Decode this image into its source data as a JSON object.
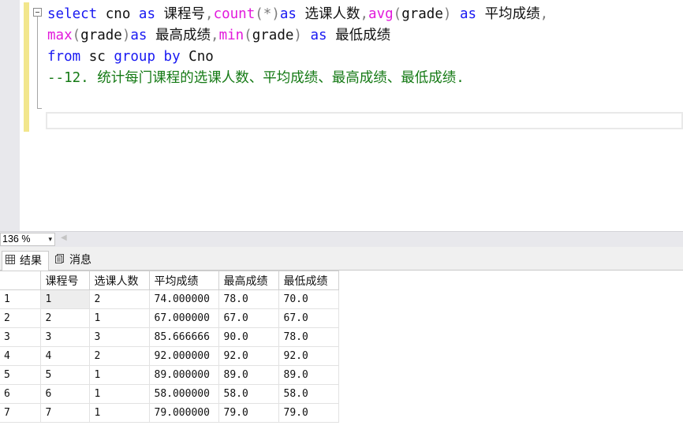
{
  "editor": {
    "lines": [
      [
        {
          "t": "select",
          "c": "kw"
        },
        {
          "t": " cno ",
          "c": "ident"
        },
        {
          "t": "as",
          "c": "kw"
        },
        {
          "t": " 课程号",
          "c": "ident"
        },
        {
          "t": ",",
          "c": "gray"
        },
        {
          "t": "count",
          "c": "fn"
        },
        {
          "t": "(*)",
          "c": "gray"
        },
        {
          "t": "as",
          "c": "kw"
        },
        {
          "t": " 选课人数",
          "c": "ident"
        },
        {
          "t": ",",
          "c": "gray"
        },
        {
          "t": "avg",
          "c": "fn"
        },
        {
          "t": "(",
          "c": "gray"
        },
        {
          "t": "grade",
          "c": "ident"
        },
        {
          "t": ")",
          "c": "gray"
        },
        {
          "t": " ",
          "c": "ident"
        },
        {
          "t": "as",
          "c": "kw"
        },
        {
          "t": " 平均成绩",
          "c": "ident"
        },
        {
          "t": ",",
          "c": "gray"
        }
      ],
      [
        {
          "t": "max",
          "c": "fn"
        },
        {
          "t": "(",
          "c": "gray"
        },
        {
          "t": "grade",
          "c": "ident"
        },
        {
          "t": ")",
          "c": "gray"
        },
        {
          "t": "as",
          "c": "kw"
        },
        {
          "t": " 最高成绩",
          "c": "ident"
        },
        {
          "t": ",",
          "c": "gray"
        },
        {
          "t": "min",
          "c": "fn"
        },
        {
          "t": "(",
          "c": "gray"
        },
        {
          "t": "grade",
          "c": "ident"
        },
        {
          "t": ")",
          "c": "gray"
        },
        {
          "t": " ",
          "c": "ident"
        },
        {
          "t": "as",
          "c": "kw"
        },
        {
          "t": " 最低成绩",
          "c": "ident"
        }
      ],
      [
        {
          "t": "from",
          "c": "kw"
        },
        {
          "t": " sc ",
          "c": "ident"
        },
        {
          "t": "group",
          "c": "kw"
        },
        {
          "t": " ",
          "c": "ident"
        },
        {
          "t": "by",
          "c": "kw"
        },
        {
          "t": " Cno",
          "c": "ident"
        }
      ],
      [
        {
          "t": "--12. 统计每门课程的选课人数、平均成绩、最高成绩、最低成绩.",
          "c": "cmt"
        }
      ]
    ]
  },
  "zoom": {
    "value": "136 %",
    "arrow": "▾"
  },
  "tabs": [
    {
      "label": "结果",
      "icon": "grid-icon"
    },
    {
      "label": "消息",
      "icon": "message-icon"
    }
  ],
  "results": {
    "columns": [
      "课程号",
      "选课人数",
      "平均成绩",
      "最高成绩",
      "最低成绩"
    ],
    "rows": [
      [
        "1",
        "1",
        "2",
        "74.000000",
        "78.0",
        "70.0"
      ],
      [
        "2",
        "2",
        "1",
        "67.000000",
        "67.0",
        "67.0"
      ],
      [
        "3",
        "3",
        "3",
        "85.666666",
        "90.0",
        "78.0"
      ],
      [
        "4",
        "4",
        "2",
        "92.000000",
        "92.0",
        "92.0"
      ],
      [
        "5",
        "5",
        "1",
        "89.000000",
        "89.0",
        "89.0"
      ],
      [
        "6",
        "6",
        "1",
        "58.000000",
        "58.0",
        "58.0"
      ],
      [
        "7",
        "7",
        "1",
        "79.000000",
        "79.0",
        "79.0"
      ]
    ]
  }
}
